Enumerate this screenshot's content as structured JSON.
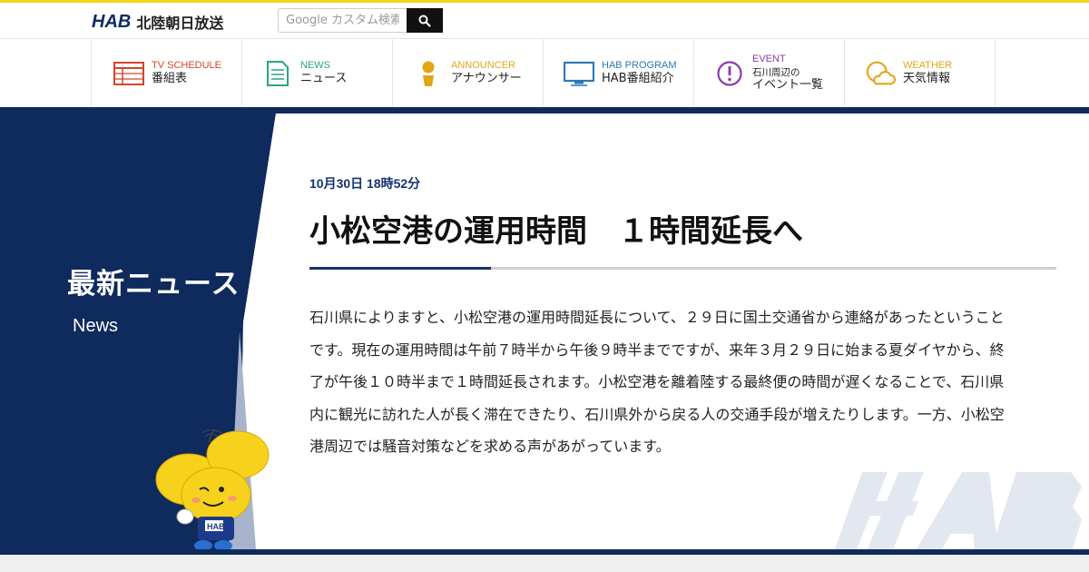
{
  "header": {
    "logo_mark": "HAB",
    "logo_text": "北陸朝日放送",
    "search_placeholder": "Google カスタム検索"
  },
  "nav": [
    {
      "en": "TV SCHEDULE",
      "jp": "番組表",
      "jp2": "",
      "icon": "tv-schedule-icon",
      "color": "#d2452a"
    },
    {
      "en": "NEWS",
      "jp": "ニュース",
      "jp2": "",
      "icon": "news-icon",
      "color": "#2aa383"
    },
    {
      "en": "ANNOUNCER",
      "jp": "アナウンサー",
      "jp2": "",
      "icon": "announcer-icon",
      "color": "#e0a614"
    },
    {
      "en": "HAB PROGRAM",
      "jp": "HAB番組紹介",
      "jp2": "",
      "icon": "monitor-icon",
      "color": "#2a79b8"
    },
    {
      "en": "EVENT",
      "jp": "石川周辺の",
      "jp2": "イベント一覧",
      "icon": "event-icon",
      "color": "#8a3aa8"
    },
    {
      "en": "WEATHER",
      "jp": "天気情報",
      "jp2": "",
      "icon": "weather-icon",
      "color": "#e0a614"
    }
  ],
  "section": {
    "title": "最新ニュース",
    "subtitle": "News"
  },
  "article": {
    "date": "10月30日 18時52分",
    "headline": "小松空港の運用時間　１時間延長へ",
    "body": "石川県によりますと、小松空港の運用時間延長について、２９日に国土交通省から連絡があったということです。現在の運用時間は午前７時半から午後９時半までですが、来年３月２９日に始まる夏ダイヤから、終了が午後１０時半まで１時間延長されます。小松空港を離着陸する最終便の時間が遅くなることで、石川県内に観光に訪れた人が長く滞在できたり、石川県外から戻る人の交通手段が増えたりします。一方、小松空港周辺では騒音対策などを求める声があがっています。"
  },
  "colors": {
    "navy": "#0f2a5c",
    "accent_yellow": "#f2d51a",
    "date_blue": "#16336e"
  },
  "watermark_text": "HAB"
}
